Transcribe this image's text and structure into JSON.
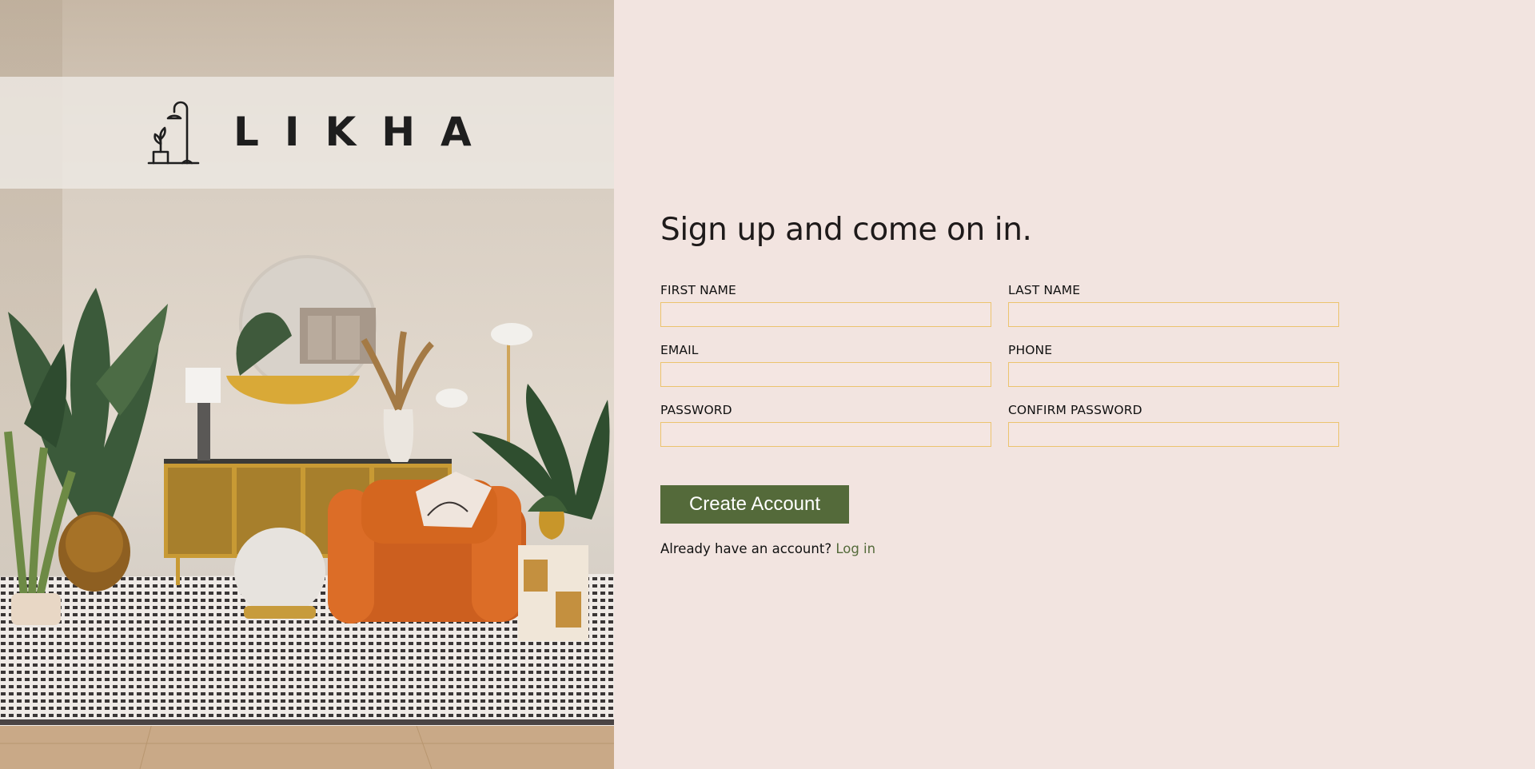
{
  "brand": {
    "name": "LIKHA",
    "logo_icon": "floor-lamp-plant-icon"
  },
  "hero": {
    "image": "living-room-scene"
  },
  "form": {
    "title": "Sign up and come on in.",
    "fields": {
      "first_name": {
        "label": "FIRST NAME",
        "value": "",
        "placeholder": ""
      },
      "last_name": {
        "label": "LAST NAME",
        "value": "",
        "placeholder": ""
      },
      "email": {
        "label": "EMAIL",
        "value": "",
        "placeholder": ""
      },
      "phone": {
        "label": "PHONE",
        "value": "",
        "placeholder": ""
      },
      "password": {
        "label": "PASSWORD",
        "value": "",
        "placeholder": ""
      },
      "confirm_password": {
        "label": "CONFIRM PASSWORD",
        "value": "",
        "placeholder": ""
      }
    },
    "submit_label": "Create Account",
    "login_prompt": "Already have an account?",
    "login_link": "Log in"
  },
  "colors": {
    "page_bg": "#f2e4e0",
    "accent_green": "#546a3a",
    "input_border": "#ecc36e",
    "title_text": "#1e1a1a"
  }
}
